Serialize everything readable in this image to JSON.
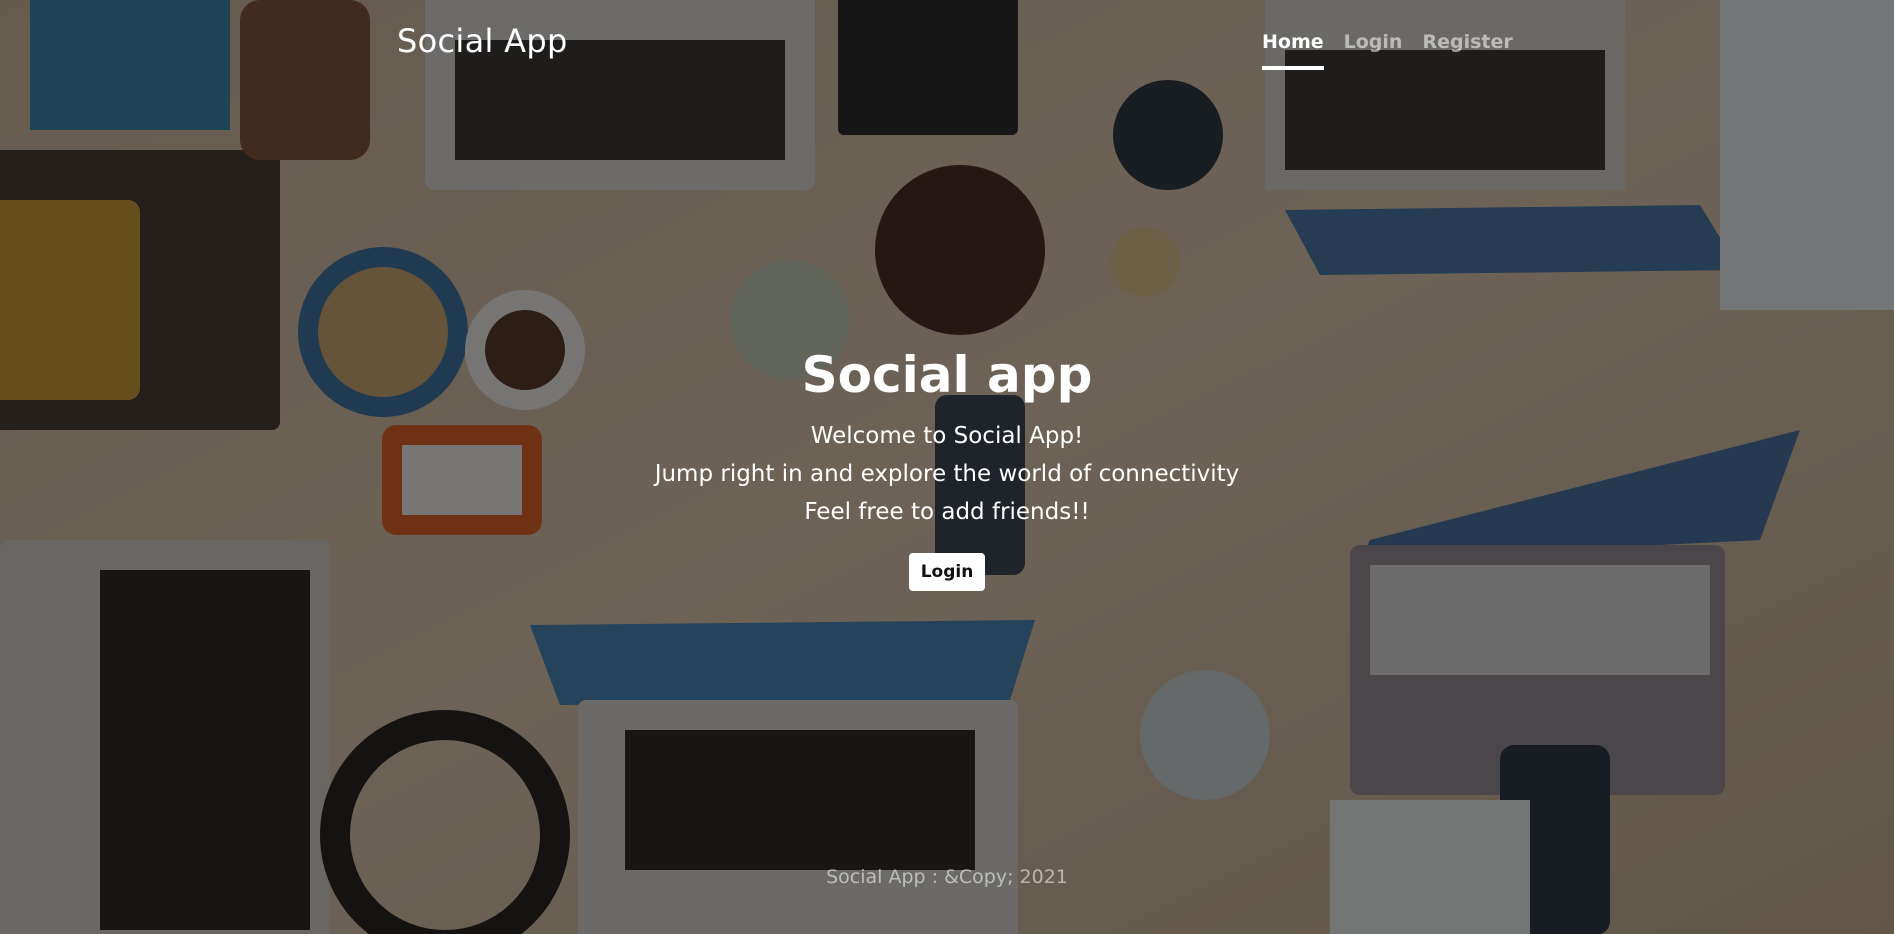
{
  "navbar": {
    "brand": "Social App",
    "links": [
      {
        "label": "Home",
        "active": true
      },
      {
        "label": "Login",
        "active": false
      },
      {
        "label": "Register",
        "active": false
      }
    ]
  },
  "hero": {
    "title": "Social app",
    "lines": [
      "Welcome to Social App!",
      "Jump right in and explore the world of connectivity",
      "Feel free to add friends!!"
    ],
    "button_label": "Login"
  },
  "footer": {
    "text": "Social App : &Copy; 2021"
  },
  "colors": {
    "overlay": "#141210",
    "text": "#ffffff",
    "nav_inactive": "#8c8a88"
  }
}
